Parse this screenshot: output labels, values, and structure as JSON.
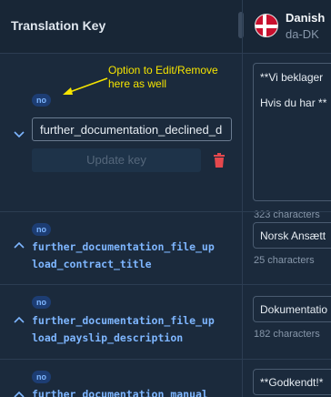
{
  "header": {
    "key_column": "Translation Key",
    "language_name": "Danish",
    "language_code": "da-DK",
    "flag_icon": "denmark-flag"
  },
  "annotation": {
    "line1": "Option to Edit/Remove",
    "line2": "here as well",
    "color": "#f5e400"
  },
  "rows": [
    {
      "badge": "no",
      "expanded": true,
      "key_value": "further_documentation_declined_d",
      "update_label": "Update key",
      "translation_line1": "**Vi beklager",
      "translation_line2": "Hvis du har **",
      "count": "323 characters"
    },
    {
      "badge": "no",
      "expanded": false,
      "key_line1": "further_documentation_file_up",
      "key_line2": "load_contract_title",
      "translation": "Norsk Ansætt",
      "count": "25 characters"
    },
    {
      "badge": "no",
      "expanded": false,
      "key_line1": "further_documentation_file_up",
      "key_line2": "load_payslip_description",
      "translation": "Dokumentatio",
      "count": "182 characters"
    },
    {
      "badge": "no",
      "expanded": false,
      "key_line1": "further_documentation_manual",
      "translation": "**Godkendt!*"
    }
  ],
  "colors": {
    "background": "#1b2a3c",
    "accent": "#7eb6ff",
    "badge_bg": "#1d3d73",
    "delete": "#e5484d"
  }
}
